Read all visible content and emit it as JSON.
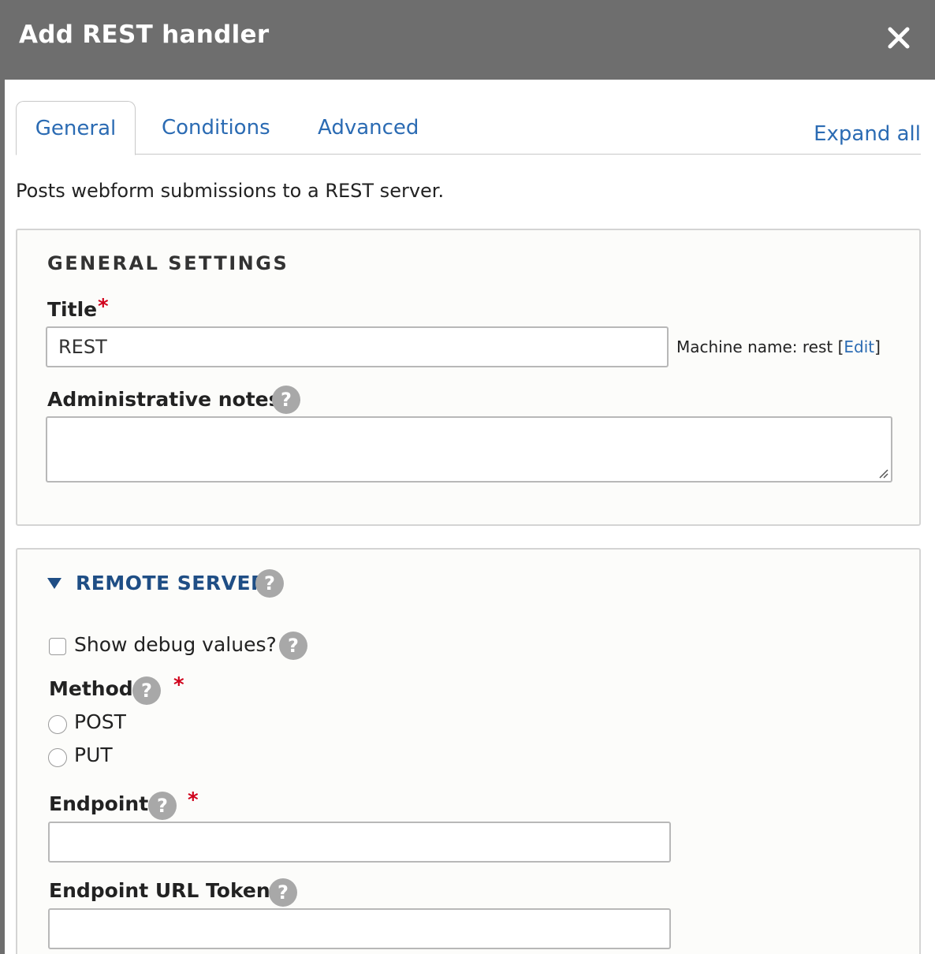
{
  "dialog": {
    "title": "Add REST handler",
    "close_icon": "close-icon"
  },
  "tabs": [
    {
      "label": "General",
      "active": true
    },
    {
      "label": "Conditions",
      "active": false
    },
    {
      "label": "Advanced",
      "active": false
    }
  ],
  "expand_all": "Expand all",
  "description": "Posts webform submissions to a REST server.",
  "general_settings": {
    "legend": "GENERAL SETTINGS",
    "title_label": "Title",
    "title_value": "REST",
    "machine_name_prefix": "Machine name: rest [",
    "machine_name_edit": "Edit",
    "machine_name_suffix": "]",
    "notes_label": "Administrative notes",
    "notes_value": ""
  },
  "remote_server": {
    "summary": "REMOTE SERVER",
    "debug_label": "Show debug values?",
    "debug_checked": false,
    "method_label": "Method",
    "method_options": [
      "POST",
      "PUT"
    ],
    "endpoint_label": "Endpoint",
    "endpoint_value": "",
    "endpoint_token_label": "Endpoint URL Token",
    "endpoint_token_value": ""
  },
  "help_glyph": "?",
  "required_glyph": "*",
  "colors": {
    "titlebar": "#6e6e6e",
    "link": "#2b6bb3",
    "summary": "#1f4e85",
    "required": "#d0021b",
    "help": "#a8a8a8"
  }
}
